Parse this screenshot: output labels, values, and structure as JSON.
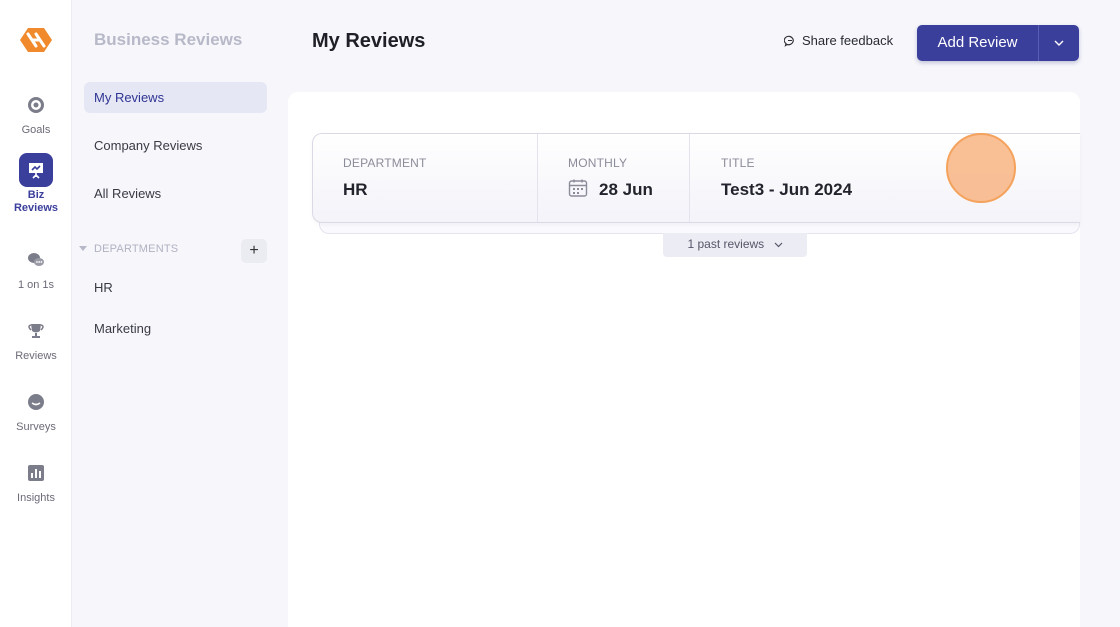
{
  "nav": {
    "items": [
      {
        "label": "Goals",
        "icon": "target-icon",
        "active": false
      },
      {
        "label": "Biz\nReviews",
        "icon": "presentation-icon",
        "active": true
      },
      {
        "label": "1 on 1s",
        "icon": "chat-bubbles-icon",
        "active": false
      },
      {
        "label": "Reviews",
        "icon": "trophy-icon",
        "active": false
      },
      {
        "label": "Surveys",
        "icon": "survey-bubble-icon",
        "active": false
      },
      {
        "label": "Insights",
        "icon": "bar-chart-icon",
        "active": false
      }
    ]
  },
  "sidebar": {
    "title": "Business Reviews",
    "items": [
      {
        "label": "My Reviews",
        "active": true
      },
      {
        "label": "Company Reviews",
        "active": false
      },
      {
        "label": "All Reviews",
        "active": false
      }
    ],
    "departments_label": "DEPARTMENTS",
    "add_label": "+",
    "departments": [
      "HR",
      "Marketing"
    ]
  },
  "header": {
    "title": "My Reviews",
    "share_feedback": "Share feedback",
    "add_review": "Add Review"
  },
  "review_card": {
    "department_label": "DEPARTMENT",
    "department_value": "HR",
    "frequency_label": "MONTHLY",
    "date_value": "28 Jun",
    "title_label": "TITLE",
    "title_value": "Test3 - Jun 2024",
    "past_reviews": "1 past reviews"
  },
  "colors": {
    "accent": "#3b3f9c",
    "logo": "#f08a2c",
    "highlight": "#f4a25c"
  }
}
